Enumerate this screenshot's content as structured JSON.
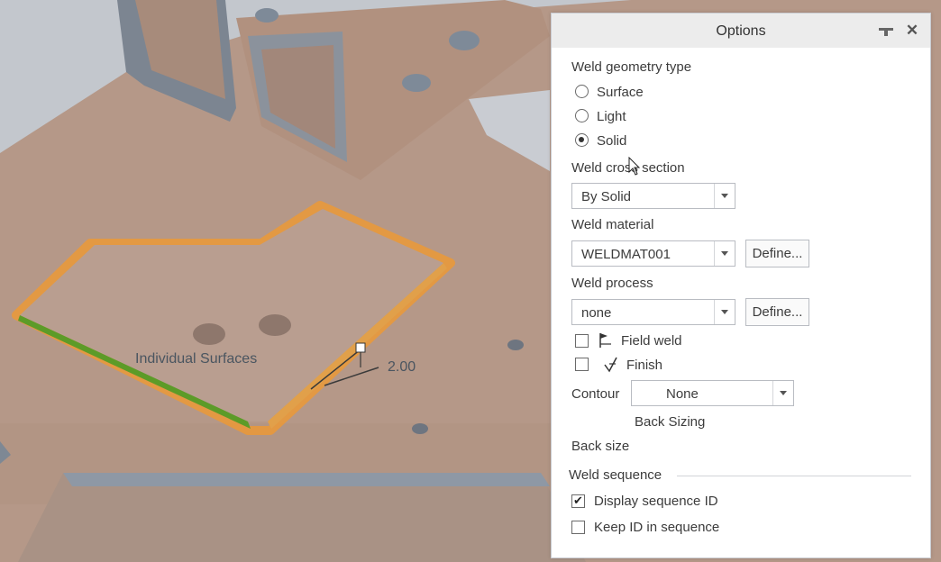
{
  "viewport": {
    "surface_label": "Individual Surfaces",
    "dimension_value": "2.00"
  },
  "panel": {
    "title": "Options",
    "pin_icon": "pin-icon",
    "close_icon": "close-icon",
    "close_glyph": "✕",
    "geometry_type": {
      "label": "Weld geometry type",
      "options": [
        "Surface",
        "Light",
        "Solid"
      ],
      "selected": "Solid"
    },
    "cross_section": {
      "label": "Weld cross section",
      "value": "By Solid"
    },
    "material": {
      "label": "Weld material",
      "value": "WELDMAT001",
      "define_label": "Define..."
    },
    "process": {
      "label": "Weld process",
      "value": "none",
      "define_label": "Define..."
    },
    "field_weld": {
      "label": "Field weld",
      "checked": false,
      "icon": "flag-icon"
    },
    "finish": {
      "label": "Finish",
      "checked": false,
      "icon": "finish-symbol-icon"
    },
    "contour": {
      "label": "Contour",
      "value": "None"
    },
    "back_sizing_label": "Back Sizing",
    "back_size_label": "Back size",
    "sequence": {
      "label": "Weld sequence",
      "display_id": {
        "label": "Display sequence ID",
        "checked": true
      },
      "keep_id": {
        "label": "Keep ID in sequence",
        "checked": false
      }
    }
  }
}
